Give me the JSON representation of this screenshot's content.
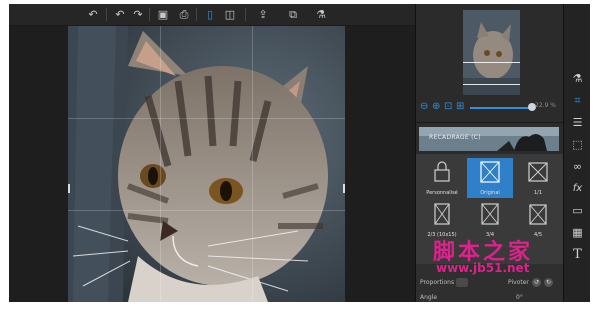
{
  "toolbar": {
    "buttons": [
      {
        "name": "undo-all-icon",
        "glyph": "↶"
      },
      {
        "name": "undo-icon",
        "glyph": "↶"
      },
      {
        "name": "redo-icon",
        "glyph": "↷"
      },
      {
        "name": "save-icon",
        "glyph": "▣"
      },
      {
        "name": "print-icon",
        "glyph": "⎙"
      },
      {
        "name": "single-view-icon",
        "glyph": "▯"
      },
      {
        "name": "compare-view-icon",
        "glyph": "◫"
      },
      {
        "name": "share-icon",
        "glyph": "⇪"
      },
      {
        "name": "batch-icon",
        "glyph": "⧉"
      },
      {
        "name": "effects-flask-icon",
        "glyph": "⚗"
      }
    ]
  },
  "navigator": {
    "zoom_value": "22.9 %"
  },
  "panel": {
    "banner_title": "RECADRAGE (C)",
    "presets": [
      {
        "label": "Personnalisé",
        "icon": "lock-icon",
        "selected": false
      },
      {
        "label": "Original",
        "icon": "crop-ratio-icon",
        "selected": true
      },
      {
        "label": "1/1",
        "icon": "crop-ratio-icon",
        "selected": false
      },
      {
        "label": "2/3 (10x15)",
        "icon": "crop-ratio-icon",
        "selected": false
      },
      {
        "label": "3/4",
        "icon": "crop-ratio-icon",
        "selected": false
      },
      {
        "label": "4/5",
        "icon": "crop-ratio-icon",
        "selected": false
      }
    ],
    "controls": {
      "proportions_label": "Proportions",
      "rotation_label": "Pivoter",
      "angle_label": "Angle",
      "angle_value": "0°"
    }
  },
  "rail": {
    "tools": [
      {
        "name": "flask-tool-icon",
        "glyph": "⚗",
        "active": false
      },
      {
        "name": "crop-tool-icon",
        "glyph": "⌗",
        "active": true
      },
      {
        "name": "adjust-tool-icon",
        "glyph": "☰",
        "active": false
      },
      {
        "name": "selection-tool-icon",
        "glyph": "⬚",
        "active": false
      },
      {
        "name": "glasses-tool-icon",
        "glyph": "∞",
        "active": false
      },
      {
        "name": "fx-tool-icon",
        "glyph": "fx",
        "active": false
      },
      {
        "name": "frame-tool-icon",
        "glyph": "▭",
        "active": false
      },
      {
        "name": "texture-tool-icon",
        "glyph": "▦",
        "active": false
      },
      {
        "name": "text-tool-icon",
        "glyph": "T",
        "active": false
      }
    ]
  },
  "watermark": {
    "text": "脚本之家",
    "url": "www.jb51.net"
  },
  "colors": {
    "accent": "#2f8fe0",
    "selected_preset": "#2f7fc9",
    "background": "#1c1c1c"
  }
}
